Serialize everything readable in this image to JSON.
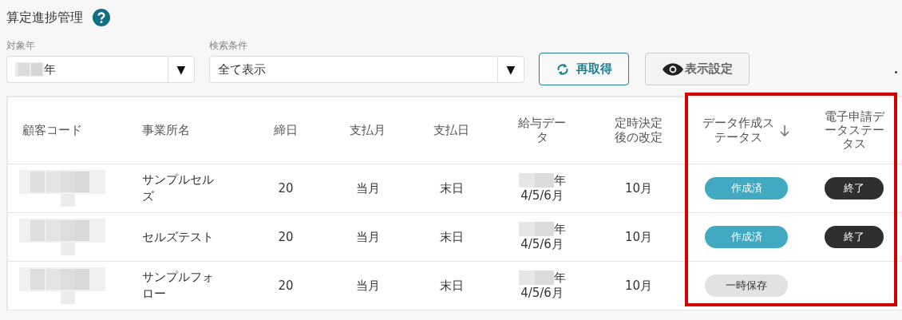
{
  "page": {
    "title": "算定進捗管理"
  },
  "filters": [
    {
      "label": "対象年",
      "value": "年",
      "arrow": "▼",
      "redacted": true
    },
    {
      "label": "検索条件",
      "value": "全て表示",
      "arrow": "▼",
      "redacted": false
    }
  ],
  "buttons": [
    {
      "kind": "refresh",
      "label": "再取得"
    },
    {
      "kind": "view",
      "label": "表示設定"
    }
  ],
  "table": {
    "columns": [
      {
        "label": "顧客コード",
        "sorted": false
      },
      {
        "label": "事業所名",
        "sorted": false
      },
      {
        "label": "締日",
        "sorted": false
      },
      {
        "label": "支払月",
        "sorted": false
      },
      {
        "label": "支払日",
        "sorted": false
      },
      {
        "label": "給与データ",
        "sorted": false
      },
      {
        "label": "定時決定後の改定",
        "sorted": false
      },
      {
        "label": "データ作成ステータス",
        "sorted": true
      },
      {
        "label": "電子申請データステータス",
        "sorted": false
      }
    ],
    "rows": [
      {
        "office": "サンプルセルズ",
        "closing": "20",
        "pay_month": "当月",
        "pay_day": "末日",
        "pay_year": "年",
        "pay_months": "4/5/6月",
        "revision": "10月",
        "data_status": {
          "kind": "done",
          "label": "作成済"
        },
        "e_status": {
          "kind": "finished",
          "label": "終了"
        }
      },
      {
        "office": "セルズテスト",
        "closing": "20",
        "pay_month": "当月",
        "pay_day": "末日",
        "pay_year": "年",
        "pay_months": "4/5/6月",
        "revision": "10月",
        "data_status": {
          "kind": "done",
          "label": "作成済"
        },
        "e_status": {
          "kind": "finished",
          "label": "終了"
        }
      },
      {
        "office": "サンプルフォロー",
        "closing": "20",
        "pay_month": "当月",
        "pay_day": "末日",
        "pay_year": "年",
        "pay_months": "4/5/6月",
        "revision": "10月",
        "data_status": {
          "kind": "draft",
          "label": "一時保存"
        }
      }
    ]
  }
}
